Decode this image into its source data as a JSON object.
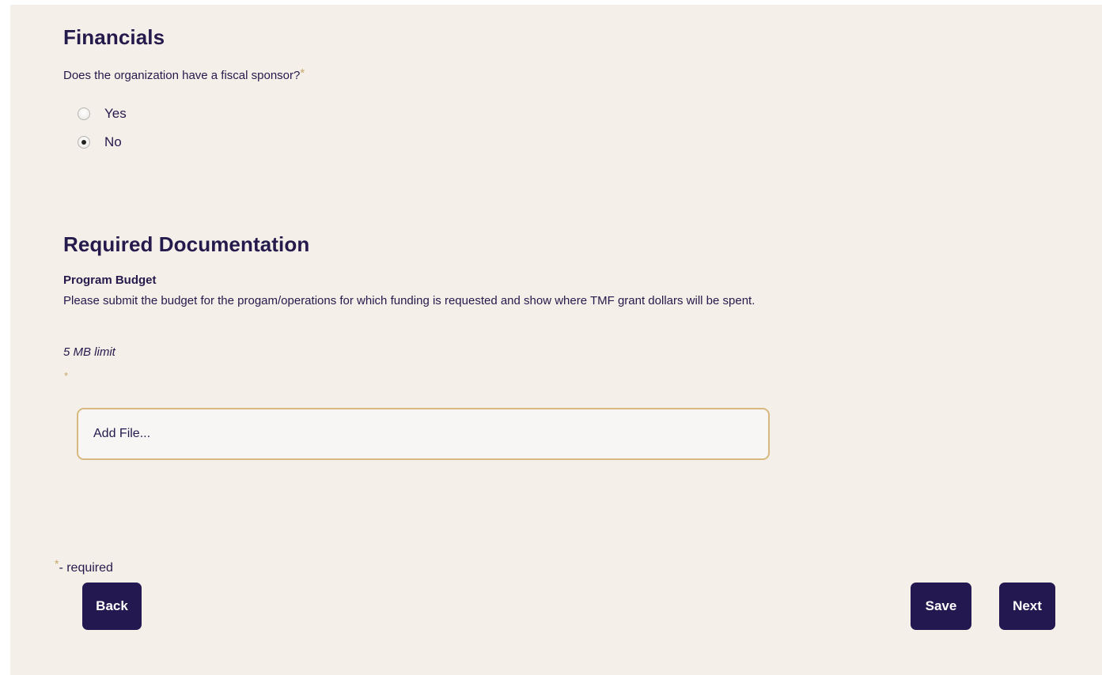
{
  "financials": {
    "title": "Financials",
    "question": "Does the organization have a fiscal sponsor?",
    "required_marker": "*",
    "options": [
      {
        "label": "Yes",
        "checked": false
      },
      {
        "label": "No",
        "checked": true
      }
    ]
  },
  "documentation": {
    "title": "Required Documentation",
    "field_label": "Program Budget",
    "description": "Please submit the budget for the progam/operations for which funding is requested and show where TMF grant dollars will be spent.",
    "limit": "5 MB limit",
    "required_marker": "*",
    "file_button_label": "Add File..."
  },
  "legend": {
    "marker": "*",
    "text": "- required"
  },
  "buttons": {
    "back": "Back",
    "save": "Save",
    "next": "Next"
  },
  "colors": {
    "background": "#f4efe8",
    "primary": "#231850",
    "accent": "#c7a66b"
  }
}
